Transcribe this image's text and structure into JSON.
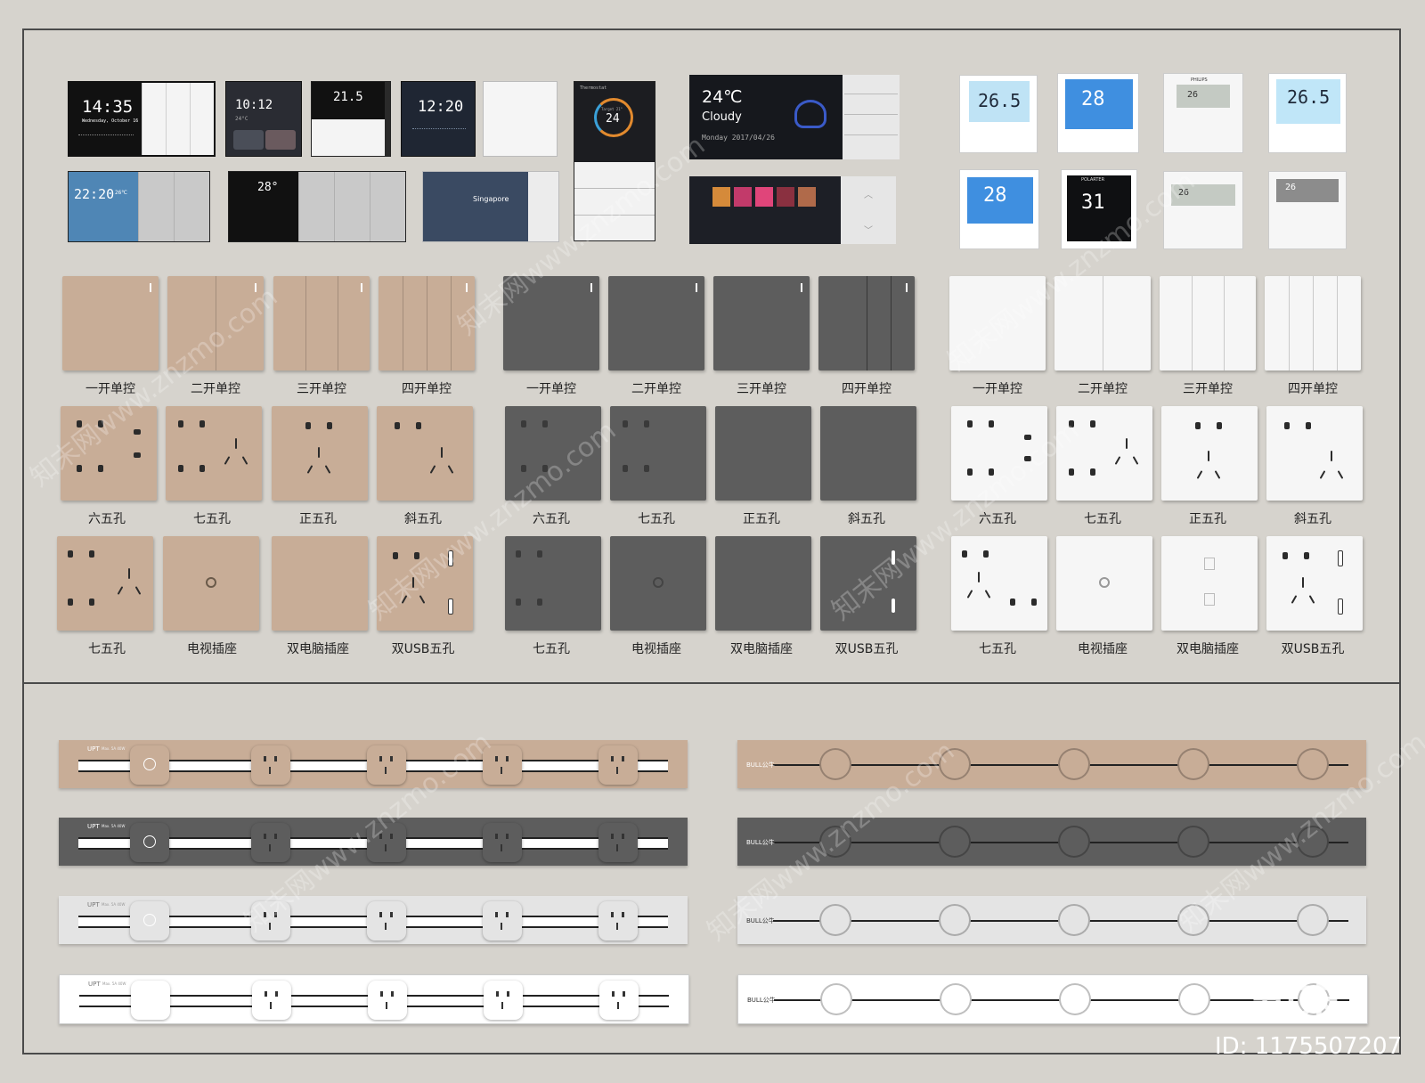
{
  "panels": {
    "p1_time": "14:35",
    "p1_date": "Wednesday, October 16",
    "p2_time": "10:12",
    "p2_temp": "24°C",
    "p3_temp": "21.5",
    "p4_time": "12:20",
    "p5_time": "22:20",
    "p5_temp": "26℃",
    "p6_temp": "28°",
    "p7_city": "Singapore",
    "therm_title": "Thermostat",
    "therm_target": "Target 21°",
    "therm_value": "24",
    "weather_temp": "24℃",
    "weather_cond": "Cloudy",
    "weather_date": "Monday   2017/04/26",
    "stat1": "26.5",
    "stat2": "28",
    "stat3": "26",
    "stat4": "26.5",
    "stat5": "28",
    "stat6": "31",
    "stat7": "26",
    "stat8": "26",
    "brand_philips": "PHILIPS",
    "brand_polarter": "POLARTER"
  },
  "groups": [
    {
      "color": "tan",
      "switches": [
        "一开单控",
        "二开单控",
        "三开单控",
        "四开单控"
      ],
      "sockets1": [
        "六五孔",
        "七五孔",
        "正五孔",
        "斜五孔"
      ],
      "sockets2": [
        "七五孔",
        "电视插座",
        "双电脑插座",
        "双USB五孔"
      ]
    },
    {
      "color": "dark",
      "switches": [
        "一开单控",
        "二开单控",
        "三开单控",
        "四开单控"
      ],
      "sockets1": [
        "六五孔",
        "七五孔",
        "正五孔",
        "斜五孔"
      ],
      "sockets2": [
        "七五孔",
        "电视插座",
        "双电脑插座",
        "双USB五孔"
      ]
    },
    {
      "color": "white",
      "switches": [
        "一开单控",
        "二开单控",
        "三开单控",
        "四开单控"
      ],
      "sockets1": [
        "六五孔",
        "七五孔",
        "正五孔",
        "斜五孔"
      ],
      "sockets2": [
        "七五孔",
        "电视插座",
        "双电脑插座",
        "双USB五孔"
      ]
    }
  ],
  "strips": {
    "left_brand": "UPT",
    "left_spec": "Max. 5A 40W",
    "right_brand": "BULL公牛",
    "left_colors": [
      "#c8ad97",
      "#5d5d5d",
      "#e4e4e4",
      "#ffffff"
    ],
    "right_colors": [
      "#c8ad97",
      "#5d5d5d",
      "#e4e4e4",
      "#ffffff"
    ]
  },
  "watermark": {
    "text": "知末网www.znzmo.com",
    "logo": "知末",
    "id": "ID: 1175507207"
  }
}
